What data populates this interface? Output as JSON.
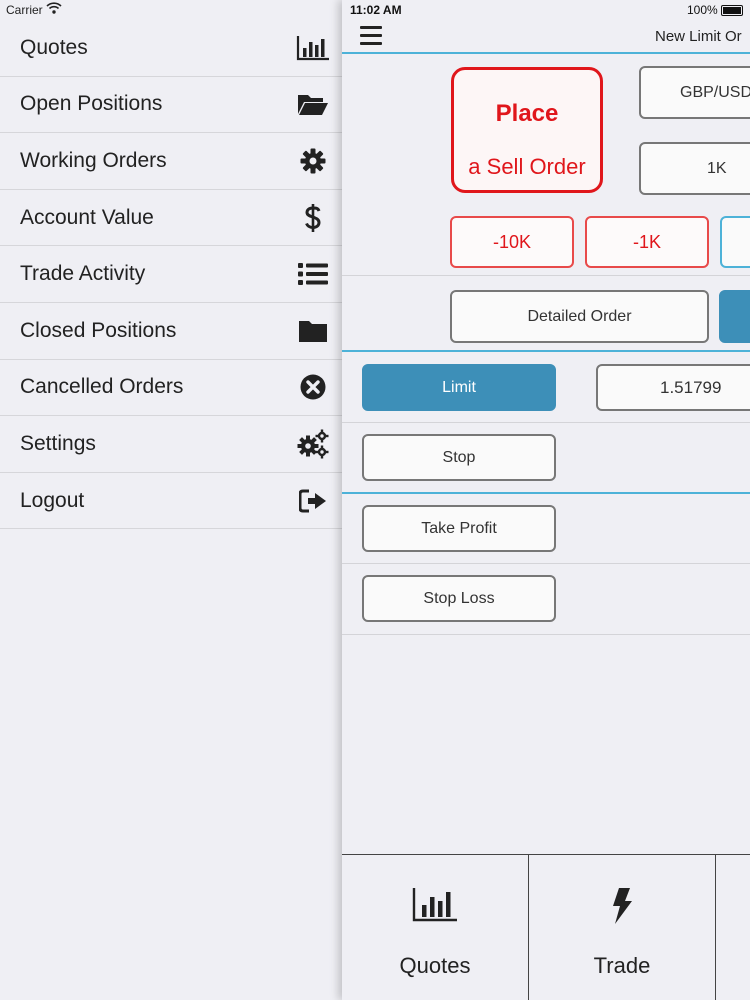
{
  "status": {
    "carrier": "Carrier",
    "time": "11:02 AM",
    "battery": "100%"
  },
  "menu": {
    "items": [
      {
        "label": "Quotes",
        "icon": "bar-chart-icon"
      },
      {
        "label": "Open Positions",
        "icon": "folder-open-icon"
      },
      {
        "label": "Working Orders",
        "icon": "gear-icon"
      },
      {
        "label": "Account Value",
        "icon": "dollar-icon"
      },
      {
        "label": "Trade Activity",
        "icon": "list-icon"
      },
      {
        "label": "Closed Positions",
        "icon": "folder-icon"
      },
      {
        "label": "Cancelled Orders",
        "icon": "close-circle-icon"
      },
      {
        "label": "Settings",
        "icon": "gears-icon"
      },
      {
        "label": "Logout",
        "icon": "sign-out-icon"
      }
    ]
  },
  "order": {
    "title": "New Limit Or",
    "sell_line1": "Place",
    "sell_line2": "a Sell Order",
    "pair": "GBP/USD",
    "quantity": "1K",
    "adjust": [
      "-10K",
      "-1K"
    ],
    "detailed_order": "Detailed Order",
    "limit_label": "Limit",
    "limit_price": "1.51799",
    "stop_label": "Stop",
    "take_profit_label": "Take Profit",
    "stop_loss_label": "Stop Loss"
  },
  "tabs": [
    {
      "label": "Quotes",
      "icon": "bar-chart-icon"
    },
    {
      "label": "Trade",
      "icon": "lightning-icon"
    }
  ],
  "colors": {
    "sell_red": "#e0161b",
    "accent_blue": "#4db2d8",
    "active_blue": "#3d8fb8",
    "background": "#efeff4"
  }
}
